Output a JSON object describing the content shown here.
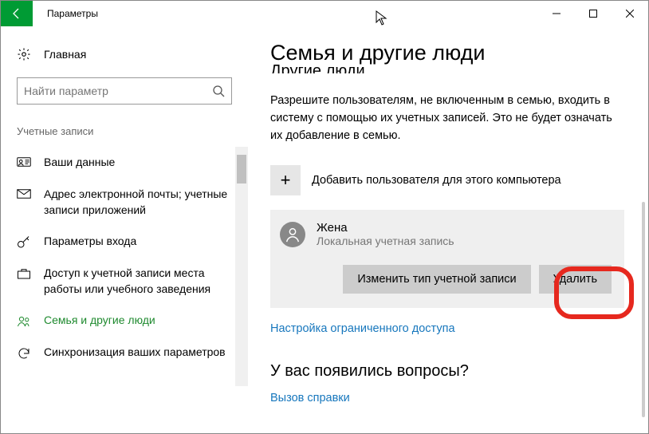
{
  "window": {
    "title": "Параметры"
  },
  "sidebar": {
    "home": "Главная",
    "search_placeholder": "Найти параметр",
    "section": "Учетные записи",
    "items": [
      {
        "label": "Ваши данные"
      },
      {
        "label": "Адрес электронной почты; учетные записи приложений"
      },
      {
        "label": "Параметры входа"
      },
      {
        "label": "Доступ к учетной записи места работы или учебного заведения"
      },
      {
        "label": "Семья и другие люди"
      },
      {
        "label": "Синхронизация ваших параметров"
      }
    ]
  },
  "main": {
    "heading": "Семья и другие люди",
    "truncated_subhead": "Другие люди",
    "description": "Разрешите пользователям, не включенным в семью, входить в систему с помощью их учетных записей. Это не будет означать их добавление в семью.",
    "add_user": "Добавить пользователя для этого компьютера",
    "user": {
      "name": "Жена",
      "type": "Локальная учетная запись"
    },
    "buttons": {
      "change_type": "Изменить тип учетной записи",
      "delete": "Удалить"
    },
    "restricted_link": "Настройка ограниченного доступа",
    "help_heading": "У вас появились вопросы?",
    "help_link": "Вызов справки"
  }
}
